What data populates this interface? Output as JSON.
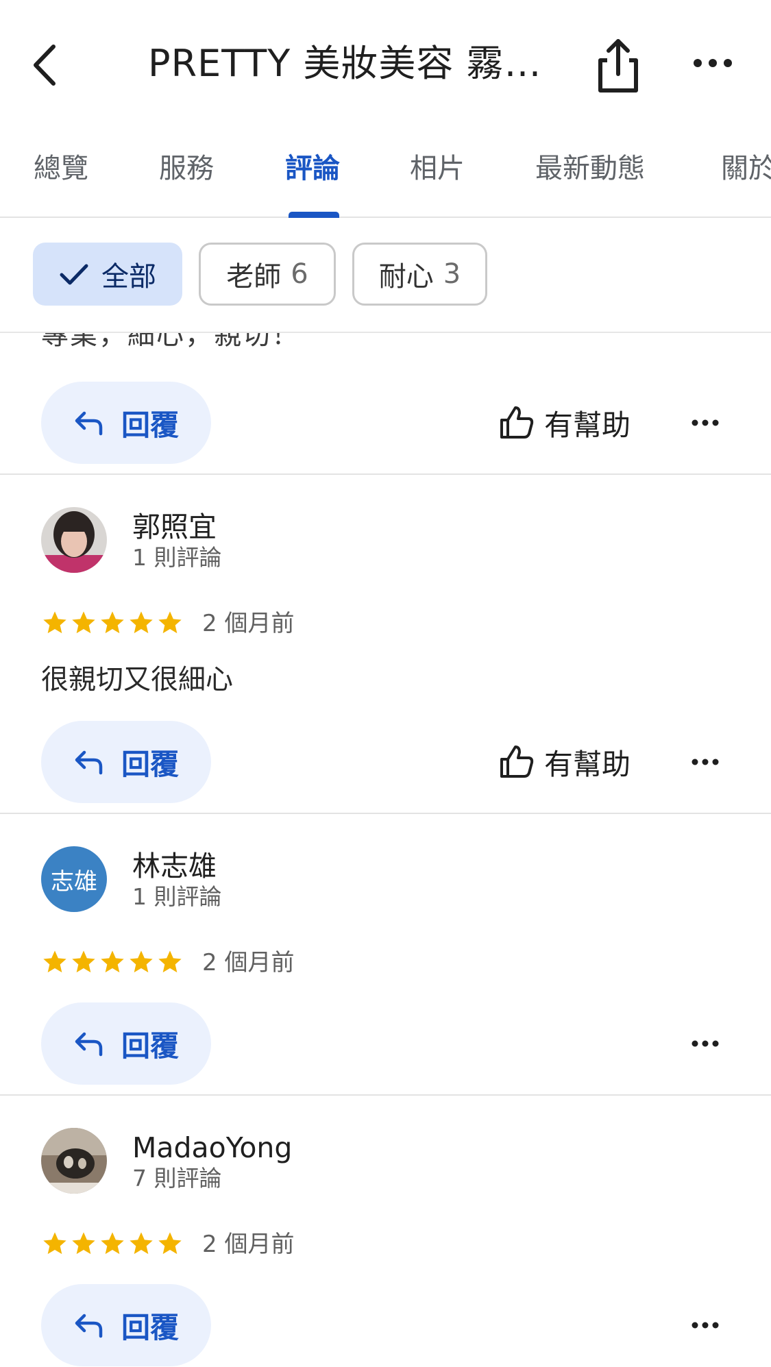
{
  "header": {
    "title": "PRETTY 美妝美容 霧…"
  },
  "tabs": [
    {
      "label": "總覽"
    },
    {
      "label": "服務"
    },
    {
      "label": "評論"
    },
    {
      "label": "相片"
    },
    {
      "label": "最新動態"
    },
    {
      "label": "關於"
    }
  ],
  "chips": [
    {
      "label": "全部",
      "count": ""
    },
    {
      "label": "老師",
      "count": "6"
    },
    {
      "label": "耐心",
      "count": "3"
    }
  ],
  "partial_review": {
    "text": "專業，細心，親切！",
    "reply_label": "回覆",
    "helpful_label": "有幫助"
  },
  "reviews": [
    {
      "name": "郭照宜",
      "review_count": "1 則評論",
      "rating": 5,
      "time": "2 個月前",
      "text": "很親切又很細心",
      "reply_label": "回覆",
      "helpful_label": "有幫助"
    },
    {
      "name": "林志雄",
      "avatar_text": "志雄",
      "review_count": "1 則評論",
      "rating": 5,
      "time": "2 個月前",
      "reply_label": "回覆"
    },
    {
      "name": "MadaoYong",
      "review_count": "7 則評論",
      "rating": 5,
      "time": "2 個月前",
      "reply_label": "回覆"
    }
  ],
  "colors": {
    "accent": "#1a56c4",
    "chip_selected": "#d6e3fa",
    "reply_bg": "#ebf1fd",
    "star": "#f4b400",
    "avatar_blue": "#3b82c4"
  }
}
